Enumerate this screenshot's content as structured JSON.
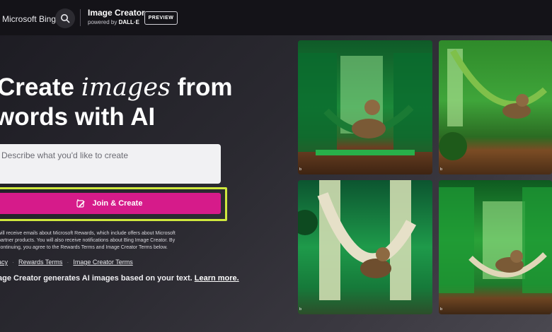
{
  "header": {
    "brand": "Microsoft Bing",
    "app_title": "Image Creator",
    "powered_by": "powered by",
    "powered_by_brand": "DALL·E",
    "preview_badge": "PREVIEW"
  },
  "hero": {
    "line1_start": "Create",
    "line1_italic": "images",
    "line1_end": "from",
    "line2": "words with AI"
  },
  "prompt": {
    "placeholder": "Describe what you'd like to create"
  },
  "create_button": {
    "label": "Join & Create"
  },
  "legal_text": "will receive emails about Microsoft Rewards, which include offers about Microsoft partner products. You will also receive notifications about Bing Image Creator. By continuing, you agree to the Rewards Terms and Image Creator Terms below.",
  "links": {
    "privacy": "acy",
    "rewards_terms": "Rewards Terms",
    "image_creator_terms": "Image Creator Terms"
  },
  "footer": {
    "note": "age Creator generates AI images based on your text.",
    "learn_more": "Learn more."
  },
  "gallery": {
    "badge_icon": "bing-b-icon",
    "tiles": [
      "sloth-hammock-green-room-1",
      "sloth-hammock-green-room-2",
      "sloth-hammock-green-room-3",
      "sloth-hammock-green-room-4"
    ]
  },
  "colors": {
    "accent_pink": "#d61b8a",
    "highlight_outline": "#cfe83e",
    "header_bg": "#141318"
  }
}
